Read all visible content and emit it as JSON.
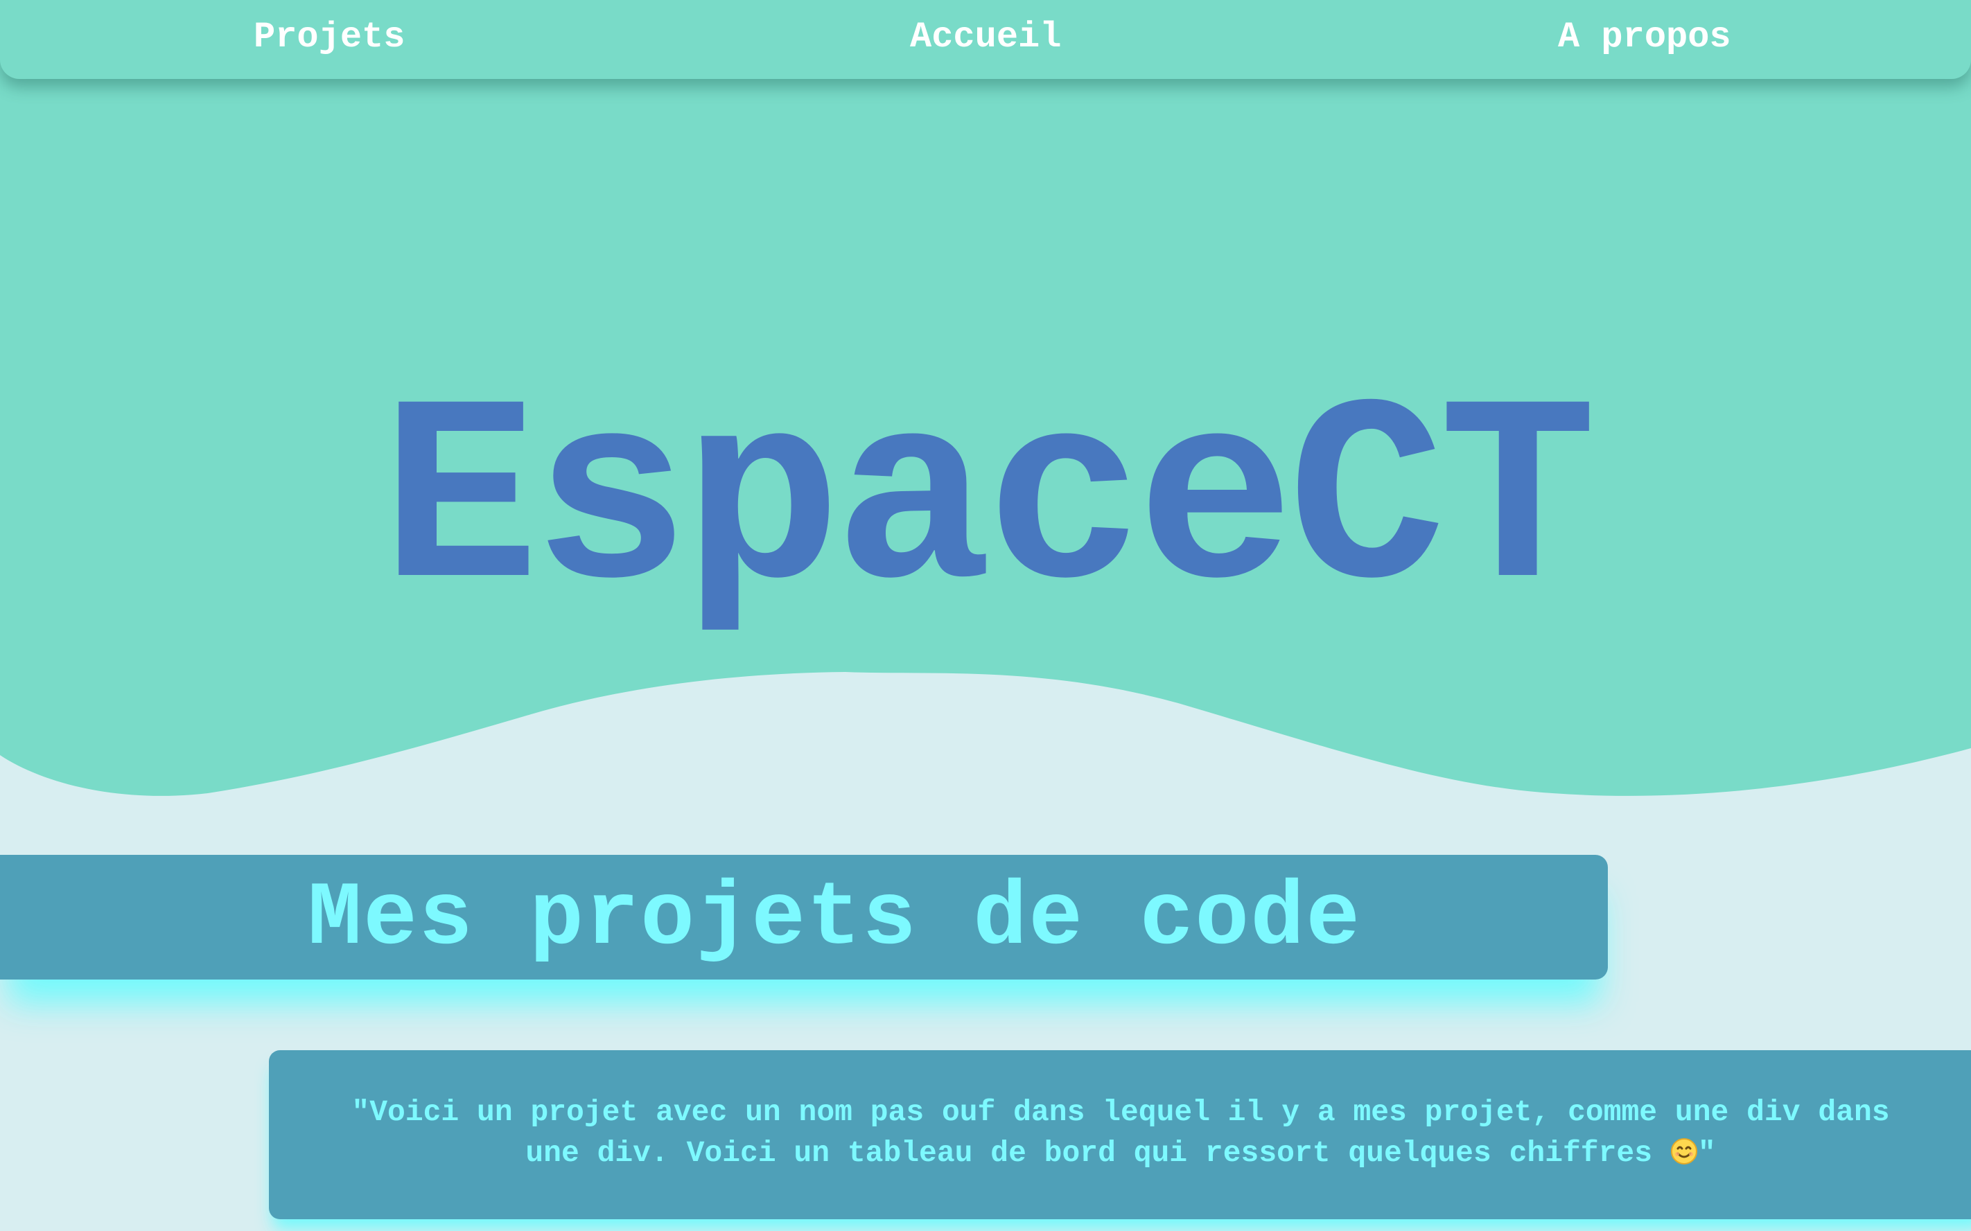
{
  "colors": {
    "hero_teal": "#79dbc8",
    "page_background": "#d8eef1",
    "title_blue": "#4878bf",
    "panel_blue": "#4fa0b8",
    "cyan_text": "#7df9ff",
    "nav_text": "#ffffff"
  },
  "nav": {
    "projets": "Projets",
    "accueil": "Accueil",
    "a_propos": "A propos"
  },
  "hero": {
    "title": "EspaceCT"
  },
  "projects_section": {
    "heading": "Mes projets de code",
    "quote_line1": "\"Voici un projet avec un nom pas ouf dans lequel il y a mes projet, comme une div dans",
    "quote_line2_start": "une div. Voici un tableau de bord qui ressort quelques chiffres ",
    "quote_emoji_icon": "smiling-face-icon",
    "quote_line2_end": "\""
  }
}
